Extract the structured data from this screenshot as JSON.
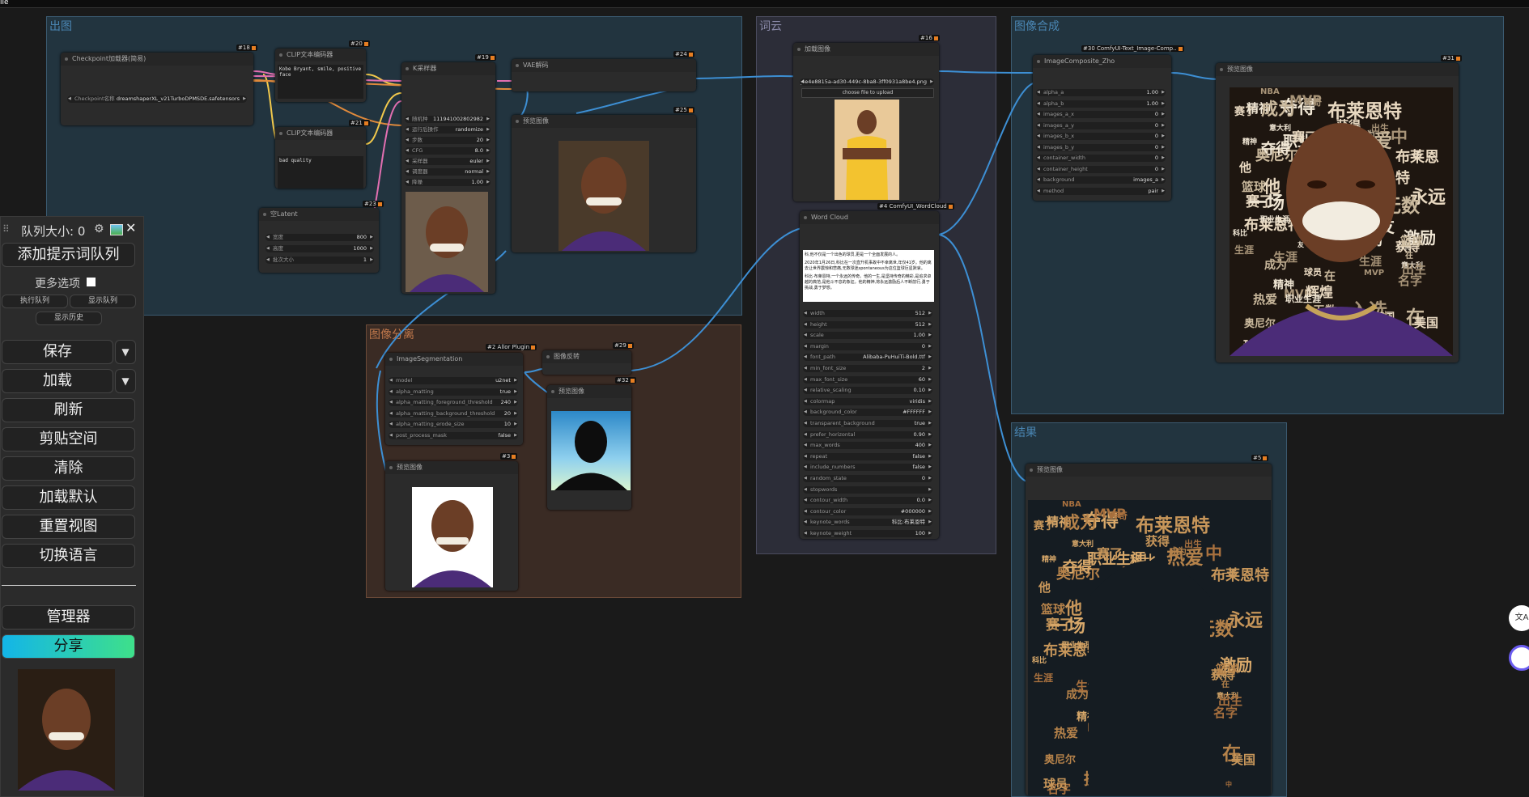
{
  "topbar": {
    "label": "lle"
  },
  "colors": {
    "wire_blue": "#3d8fd4",
    "wire_yellow": "#f2c94c",
    "wire_pink": "#e26fb1",
    "wire_orange": "#e08a3c",
    "share_start": "#13b5e8",
    "share_end": "#3ee08a"
  },
  "groups": {
    "g1": "出图",
    "g2": "词云",
    "g3": "图像合成",
    "g4": "图像分离",
    "g5": "结果"
  },
  "nodes": {
    "checkpoint": {
      "title": "Checkpoint加载器(简易)",
      "id": "#18",
      "w_label": "Checkpoint名称",
      "w_value": "dreamshaperXL_v21TurboDPMSDE.safetensors"
    },
    "clip1": {
      "title": "CLIP文本编码器",
      "id": "#20",
      "text": "Kobe Bryant, smile, positive face"
    },
    "clip2": {
      "title": "CLIP文本编码器",
      "id": "#21",
      "text": "bad quality"
    },
    "ksampler": {
      "title": "K采样器",
      "id": "#19",
      "widgets": [
        {
          "label": "随机种",
          "value": "111941002802982"
        },
        {
          "label": "运行后操作",
          "value": "randomize"
        },
        {
          "label": "步数",
          "value": "20"
        },
        {
          "label": "CFG",
          "value": "8.0"
        },
        {
          "label": "采样器",
          "value": "euler"
        },
        {
          "label": "调度器",
          "value": "normal"
        },
        {
          "label": "降噪",
          "value": "1.00"
        }
      ]
    },
    "latent": {
      "title": "空Latent",
      "id": "#23",
      "widgets": [
        {
          "label": "宽度",
          "value": "800"
        },
        {
          "label": "高度",
          "value": "1000"
        },
        {
          "label": "批次大小",
          "value": "1"
        }
      ]
    },
    "vae": {
      "title": "VAE解码",
      "id": "#24"
    },
    "preview25": {
      "title": "预览图像",
      "id": "#25"
    },
    "loadimg": {
      "title": "加载图像",
      "id": "#16",
      "file": "safaridinsalim_LA_Lakers_Kobe_Bryant_wearing_jersey_number_24_b_4e4e8815a-ad30-449c-8ba8-3ff0931a8be4.png",
      "upload": "choose file to upload"
    },
    "wordcloud": {
      "title": "Word Cloud",
      "id": "#4 ComfyUI_WordCloud",
      "text1": "科,他不仅是一个出色的球员,更是一个全面发展的人。",
      "text2": "2020年1月26日,科比在一次直升机事故中不幸离世,年仅41岁。他的离去让世界震惊和悲痛,无数球迷spontaneous为这位篮球巨星默哀。",
      "text3": "科比·布莱恩特,一个永远的传奇。他的一生,是坚持传奇的精彩,是追求卓越的典范,是他斗不息的象征。他的精神,将永远激励后人不断前行,勇于挑战,勇于梦想。",
      "widgets": [
        {
          "label": "width",
          "value": "512"
        },
        {
          "label": "height",
          "value": "512"
        },
        {
          "label": "scale",
          "value": "1.00"
        },
        {
          "label": "margin",
          "value": "0"
        },
        {
          "label": "font_path",
          "value": "Alibaba-PuHuiTi-Bold.ttf"
        },
        {
          "label": "min_font_size",
          "value": "2"
        },
        {
          "label": "max_font_size",
          "value": "60"
        },
        {
          "label": "relative_scaling",
          "value": "0.10"
        },
        {
          "label": "colormap",
          "value": "viridis"
        },
        {
          "label": "background_color",
          "value": "#FFFFFF"
        },
        {
          "label": "transparent_background",
          "value": "true"
        },
        {
          "label": "prefer_horizontal",
          "value": "0.90"
        },
        {
          "label": "max_words",
          "value": "400"
        },
        {
          "label": "repeat",
          "value": "false"
        },
        {
          "label": "include_numbers",
          "value": "false"
        },
        {
          "label": "random_state",
          "value": "0"
        },
        {
          "label": "stopwords",
          "value": ""
        },
        {
          "label": "contour_width",
          "value": "0.0"
        },
        {
          "label": "contour_color",
          "value": "#000000"
        },
        {
          "label": "keynote_words",
          "value": "科比:布莱恩特"
        },
        {
          "label": "keynote_weight",
          "value": "100"
        }
      ]
    },
    "composite": {
      "title": "ImageComposite_Zho",
      "id": "#30 ComfyUI-Text_Image-Comp..",
      "widgets": [
        {
          "label": "alpha_a",
          "value": "1.00"
        },
        {
          "label": "alpha_b",
          "value": "1.00"
        },
        {
          "label": "images_a_x",
          "value": "0"
        },
        {
          "label": "images_a_y",
          "value": "0"
        },
        {
          "label": "images_b_x",
          "value": "0"
        },
        {
          "label": "images_b_y",
          "value": "0"
        },
        {
          "label": "container_width",
          "value": "0"
        },
        {
          "label": "container_height",
          "value": "0"
        },
        {
          "label": "background",
          "value": "images_a"
        },
        {
          "label": "method",
          "value": "pair"
        }
      ]
    },
    "preview31": {
      "title": "预览图像",
      "id": "#31"
    },
    "segmentation": {
      "title": "ImageSegmentation",
      "id": "#2 Allor Plugin",
      "widgets": [
        {
          "label": "model",
          "value": "u2net"
        },
        {
          "label": "alpha_matting",
          "value": "true"
        },
        {
          "label": "alpha_matting_foreground_threshold",
          "value": "240"
        },
        {
          "label": "alpha_matting_background_threshold",
          "value": "20"
        },
        {
          "label": "alpha_matting_erode_size",
          "value": "10"
        },
        {
          "label": "post_process_mask",
          "value": "false"
        }
      ]
    },
    "invert": {
      "title": "图像反转",
      "id": "#29"
    },
    "preview32": {
      "title": "预览图像",
      "id": "#32"
    },
    "preview3": {
      "title": "预览图像",
      "id": "#3"
    },
    "preview5": {
      "title": "预览图像",
      "id": "#5"
    }
  },
  "wordcloud_words": [
    "获得",
    "热爱",
    "夺得",
    "MVP",
    "布莱恩特",
    "成为",
    "科比",
    "中",
    "他",
    "篮球",
    "职业生涯",
    "NBA",
    "赛了",
    "年",
    "一场",
    "传奇",
    "辉煌",
    "奥尼尔",
    "精神",
    "生涯",
    "永远",
    "无数",
    "意大利",
    "出生",
    "美国",
    "在",
    "激励",
    "入选",
    "球员",
    "挑战",
    "友",
    "名字"
  ],
  "menu": {
    "queue_size": "队列大小: 0",
    "add_prompt": "添加提示词队列",
    "more_options": "更多选项",
    "exec_queue": "执行队列",
    "show_queue": "显示队列",
    "show_history": "显示历史",
    "save": "保存",
    "load": "加载",
    "refresh": "刷新",
    "clipspace": "剪贴空间",
    "clear": "清除",
    "load_default": "加载默认",
    "reset_view": "重置视图",
    "switch_lang": "切换语言",
    "manager": "管理器",
    "share": "分享"
  }
}
